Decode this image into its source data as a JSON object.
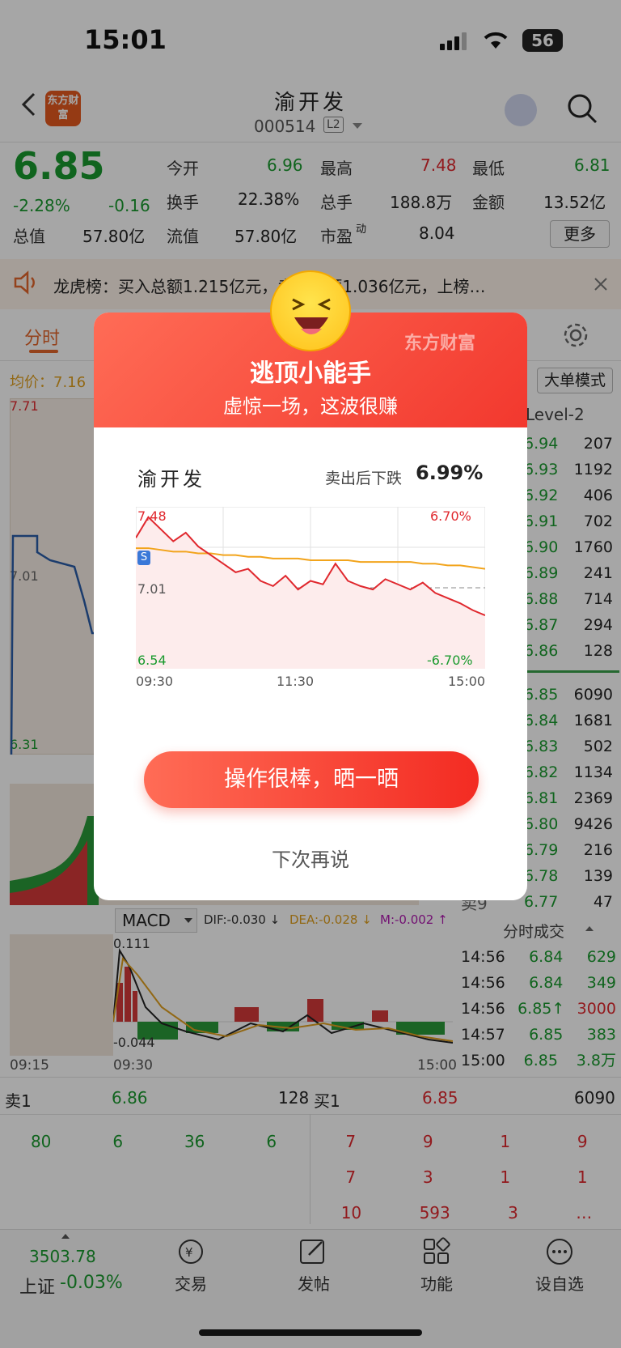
{
  "status_bar": {
    "time": "15:01",
    "battery": "56"
  },
  "header": {
    "stock_name": "渝开发",
    "stock_code": "000514",
    "level_badge": "L2",
    "logo_text": "东方财富"
  },
  "quote": {
    "price": "6.85",
    "change_pct": "-2.28%",
    "change": "-0.16",
    "open_label": "今开",
    "open": "6.96",
    "high_label": "最高",
    "high": "7.48",
    "low_label": "最低",
    "low": "6.81",
    "turnover_label": "换手",
    "turnover": "22.38%",
    "volume_label": "总手",
    "volume": "188.8万",
    "amount_label": "金额",
    "amount": "13.52亿",
    "mktcap_label": "总值",
    "mktcap": "57.80亿",
    "float_label": "流值",
    "float": "57.80亿",
    "pe_label": "市盈",
    "pe_sup": "动",
    "pe": "8.04",
    "more": "更多"
  },
  "notice": {
    "text": "龙虎榜：买入总额1.215亿元，卖出总额1.036亿元，上榜…"
  },
  "tabs": {
    "active": "分时"
  },
  "chart_side": {
    "avg_label": "均价：7.16",
    "top": "7.71",
    "mid": "7.01",
    "bottom": "6.31",
    "big_order": "大单模式",
    "level2": "Level-2"
  },
  "order_book": {
    "ask_prices": [
      "6.94",
      "6.93",
      "6.92",
      "6.91",
      "6.90",
      "6.89",
      "6.88",
      "6.87",
      "6.86"
    ],
    "ask_vols": [
      "207",
      "1192",
      "406",
      "702",
      "1760",
      "241",
      "714",
      "294",
      "128"
    ],
    "bid_prices": [
      "6.85",
      "6.84",
      "6.83",
      "6.82",
      "6.81",
      "6.80",
      "6.79",
      "6.78",
      "6.77"
    ],
    "bid_vols": [
      "6090",
      "1681",
      "502",
      "1134",
      "2369",
      "9426",
      "216",
      "139",
      "47"
    ]
  },
  "macd": {
    "label": "MACD",
    "dif": "DIF:-0.030 ↓",
    "dea": "DEA:-0.028 ↓",
    "m": "M:-0.002 ↑",
    "top": "0.111",
    "bottom": "-0.044",
    "t0": "09:15",
    "t1": "09:30",
    "t2": "15:00"
  },
  "trades": {
    "title": "分时成交",
    "rows": [
      {
        "t": "14:56",
        "p": "6.84",
        "v": "629"
      },
      {
        "t": "14:56",
        "p": "6.84",
        "v": "349"
      },
      {
        "t": "14:56",
        "p": "6.85↑",
        "v": "3000"
      },
      {
        "t": "14:57",
        "p": "6.85",
        "v": "383"
      },
      {
        "t": "15:00",
        "p": "6.85",
        "v": "3.8万"
      }
    ]
  },
  "bottom_book": {
    "sell1_label": "卖1",
    "sell1_price": "6.86",
    "sell1_vol": "128",
    "buy1_label": "买1",
    "buy1_price": "6.85",
    "buy1_vol": "6090",
    "left_queue": [
      "80",
      "6",
      "36",
      "6"
    ],
    "right_row1": [
      "7",
      "9",
      "1",
      "9"
    ],
    "right_row2": [
      "7",
      "3",
      "1",
      "1"
    ],
    "right_row3": [
      "10",
      "593",
      "3",
      "…"
    ]
  },
  "nav": {
    "index_value": "3503.78",
    "index_name": "上证",
    "index_change": "-0.03%",
    "items": [
      "交易",
      "发帖",
      "功能",
      "设自选"
    ]
  },
  "modal": {
    "brand": "东方财富",
    "title": "逃顶小能手",
    "subtitle": "虚惊一场，这波很赚",
    "stock_name": "渝开发",
    "drop_label": "卖出后下跌",
    "drop_value": "6.99%",
    "share_button": "操作很棒，晒一晒",
    "later": "下次再说"
  },
  "chart_data": {
    "type": "line",
    "x_ticks": [
      "09:30",
      "11:30",
      "15:00"
    ],
    "y_top_left": "7.48",
    "y_top_right": "6.70%",
    "y_mid_left": "7.01",
    "y_bottom_left": "6.54",
    "y_bottom_right": "-6.70%",
    "ylim": [
      6.54,
      7.48
    ],
    "series": [
      {
        "values": [
          7.3,
          7.42,
          7.35,
          7.28,
          7.33,
          7.25,
          7.2,
          7.15,
          7.1,
          7.12,
          7.05,
          7.02,
          7.08,
          7.0,
          7.05,
          7.03,
          7.15,
          7.05,
          7.02,
          7.0,
          7.06,
          7.03,
          7.0,
          7.04,
          6.98,
          6.95,
          6.92,
          6.88,
          6.85
        ]
      },
      {
        "values": [
          7.24,
          7.24,
          7.23,
          7.22,
          7.22,
          7.21,
          7.21,
          7.2,
          7.2,
          7.19,
          7.19,
          7.18,
          7.18,
          7.18,
          7.17,
          7.17,
          7.17,
          7.17,
          7.16,
          7.16,
          7.16,
          7.16,
          7.16,
          7.15,
          7.15,
          7.14,
          7.14,
          7.13,
          7.12
        ]
      }
    ],
    "markers": [
      "S"
    ]
  },
  "colors": {
    "up": "#e0282e",
    "down": "#1a9a2e",
    "accent": "#e3662b",
    "avg_line": "#f2a41c"
  }
}
